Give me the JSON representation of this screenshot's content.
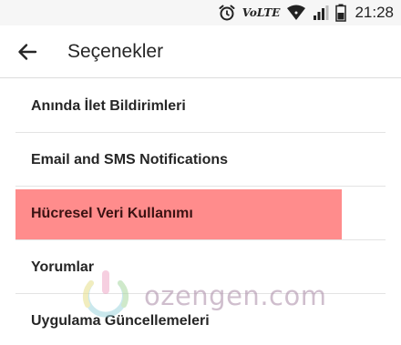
{
  "status_bar": {
    "network_label": "VoLTE",
    "time": "21:28",
    "icons": [
      "alarm-icon",
      "wifi-icon",
      "signal-icon",
      "battery-icon"
    ]
  },
  "app_bar": {
    "back_icon": "arrow-left-icon",
    "title": "Seçenekler"
  },
  "settings": {
    "items": [
      {
        "label": "Anında İlet Bildirimleri"
      },
      {
        "label": "Email and SMS Notifications"
      },
      {
        "label": "Hücresel Veri Kullanımı",
        "highlighted": true
      },
      {
        "label": "Yorumlar"
      },
      {
        "label": "Uygulama Güncellemeleri"
      }
    ]
  },
  "watermark": {
    "text": "ozengen.com"
  },
  "colors": {
    "highlight": "#ff8c8c",
    "divider": "#e3e3e3",
    "text": "#262626"
  }
}
